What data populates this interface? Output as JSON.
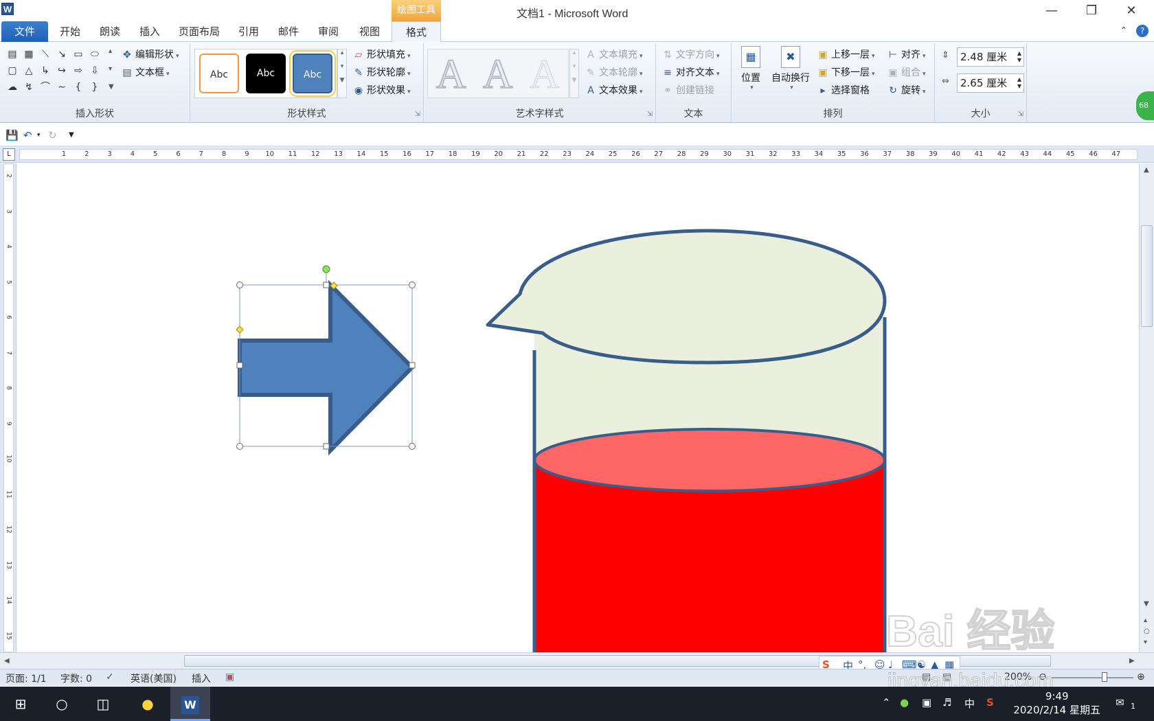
{
  "window": {
    "title": "文档1 - Microsoft Word",
    "context_tab_group": "绘图工具",
    "app_icon": "W"
  },
  "tabs": {
    "file": "文件",
    "items": [
      "开始",
      "朗读",
      "插入",
      "页面布局",
      "引用",
      "邮件",
      "审阅",
      "视图",
      "格式"
    ],
    "active": "格式"
  },
  "ribbon": {
    "insert_shapes": {
      "label": "插入形状",
      "edit_shape": "编辑形状",
      "text_box": "文本框"
    },
    "shape_styles": {
      "label": "形状样式",
      "thumb_text": "Abc",
      "fill": "形状填充",
      "outline": "形状轮廓",
      "effects": "形状效果"
    },
    "wordart_styles": {
      "label": "艺术字样式",
      "sample": "A",
      "text_fill": "文本填充",
      "text_outline": "文本轮廓",
      "text_effects": "文本效果"
    },
    "text": {
      "label": "文本",
      "direction": "文字方向",
      "align_text": "对齐文本",
      "create_link": "创建链接"
    },
    "arrange": {
      "label": "排列",
      "position": "位置",
      "wrap": "自动换行",
      "bring_forward": "上移一层",
      "send_backward": "下移一层",
      "selection_pane": "选择窗格",
      "align": "对齐",
      "group": "组合",
      "rotate": "旋转"
    },
    "size": {
      "label": "大小",
      "height": "2.48 厘米",
      "width": "2.65 厘米"
    },
    "badge": "68"
  },
  "ruler": {
    "h_ticks": [
      "1",
      "2",
      "3",
      "4",
      "5",
      "6",
      "7",
      "8",
      "9",
      "10",
      "11",
      "12",
      "13",
      "14",
      "15",
      "16",
      "17",
      "18",
      "19",
      "20",
      "21",
      "22",
      "23",
      "24",
      "25",
      "26",
      "27",
      "28",
      "29",
      "30",
      "31",
      "32",
      "33",
      "34",
      "35",
      "36",
      "37",
      "38",
      "39",
      "40",
      "41",
      "42",
      "43",
      "44",
      "45",
      "46",
      "47"
    ],
    "v_ticks": [
      "2",
      "3",
      "4",
      "5",
      "6",
      "7",
      "8",
      "9",
      "10",
      "11",
      "12",
      "13",
      "14",
      "15"
    ]
  },
  "status": {
    "page": "页面: 1/1",
    "words": "字数: 0",
    "language": "英语(美国)",
    "mode": "插入",
    "zoom": "200%"
  },
  "ime": {
    "lang": "中",
    "punct": "°,"
  },
  "taskbar": {
    "time": "9:49",
    "date": "2020/2/14 星期五",
    "ime_indicator": "中",
    "notifications": "1"
  },
  "watermark": {
    "brand": "Bai 经验",
    "url": "jingyan.baidu.com"
  },
  "colors": {
    "shape_fill": "#4f81bd",
    "shape_outline": "#385d8a",
    "beaker_body": "#ebf0de",
    "liquid": "#ff0000",
    "liquid_top": "#ff6666",
    "context_orange": "#f2a43a"
  }
}
